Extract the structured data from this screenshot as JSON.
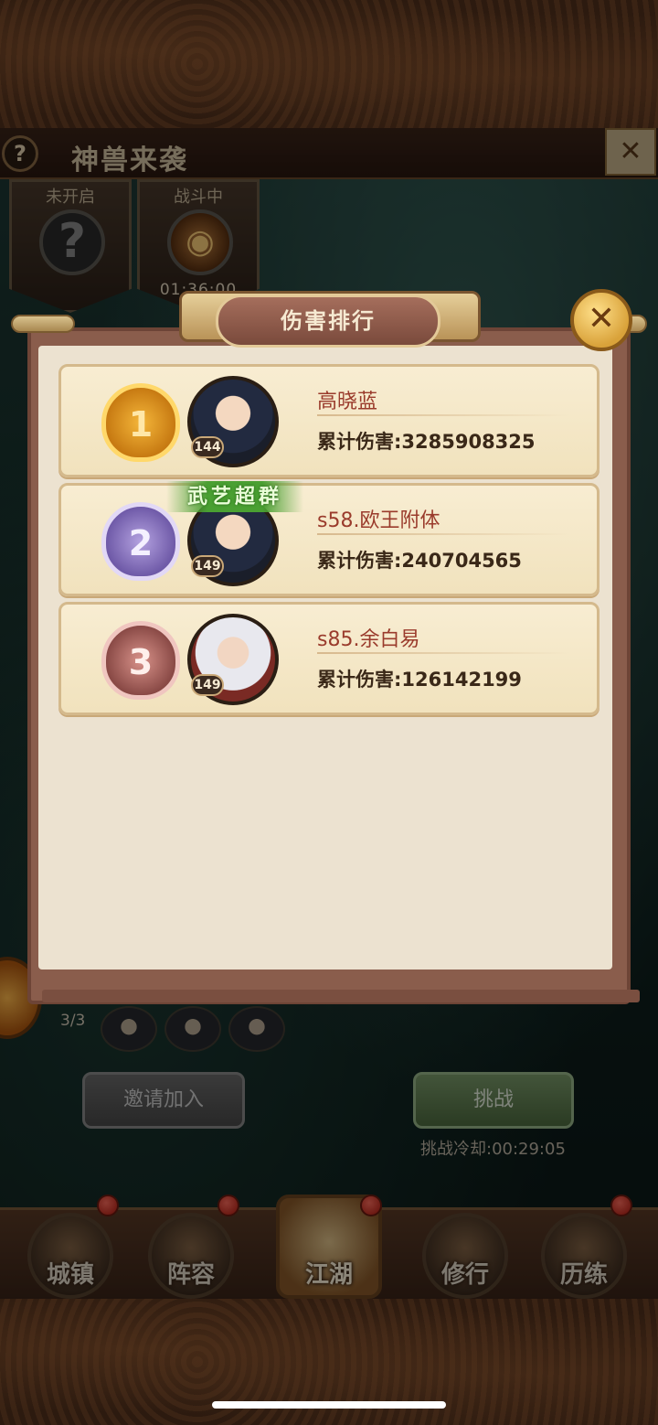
{
  "title_bar": {
    "help_icon": "question-mark-icon",
    "title": "神兽来袭",
    "close_icon": "close-icon"
  },
  "tabs": [
    {
      "label": "未开启",
      "icon": "question-mark-icon",
      "timer": ""
    },
    {
      "label": "战斗中",
      "icon": "beast-portrait-icon",
      "timer": "01:36:00"
    }
  ],
  "ranking_panel": {
    "header": "伤害排行",
    "close_icon": "close-icon",
    "entries": [
      {
        "rank": "1",
        "name": "高晓蓝",
        "level": "144",
        "damage": "累计伤害:3285908325",
        "title_badge": ""
      },
      {
        "rank": "2",
        "name": "s58.欧王附体",
        "level": "149",
        "damage": "累计伤害:240704565",
        "title_badge": "武艺超群"
      },
      {
        "rank": "3",
        "name": "s85.余白易",
        "level": "149",
        "damage": "累计伤害:126142199",
        "title_badge": ""
      }
    ]
  },
  "team": {
    "count": "3/3"
  },
  "actions": {
    "invite_label": "邀请加入",
    "challenge_label": "挑战",
    "cooldown": "挑战冷却:00:29:05"
  },
  "nav": {
    "items": [
      {
        "label": "城镇",
        "icon": "town-icon"
      },
      {
        "label": "阵容",
        "icon": "lineup-icon"
      },
      {
        "label": "江湖",
        "icon": "jianghu-scroll-icon"
      },
      {
        "label": "修行",
        "icon": "cultivation-icon"
      },
      {
        "label": "历练",
        "icon": "training-icon"
      }
    ]
  },
  "colors": {
    "accent_gold": "#d9a23a",
    "panel_brown": "#8a5d4c",
    "name_red": "#9a3b2c",
    "challenge_green": "#4e6c40"
  }
}
